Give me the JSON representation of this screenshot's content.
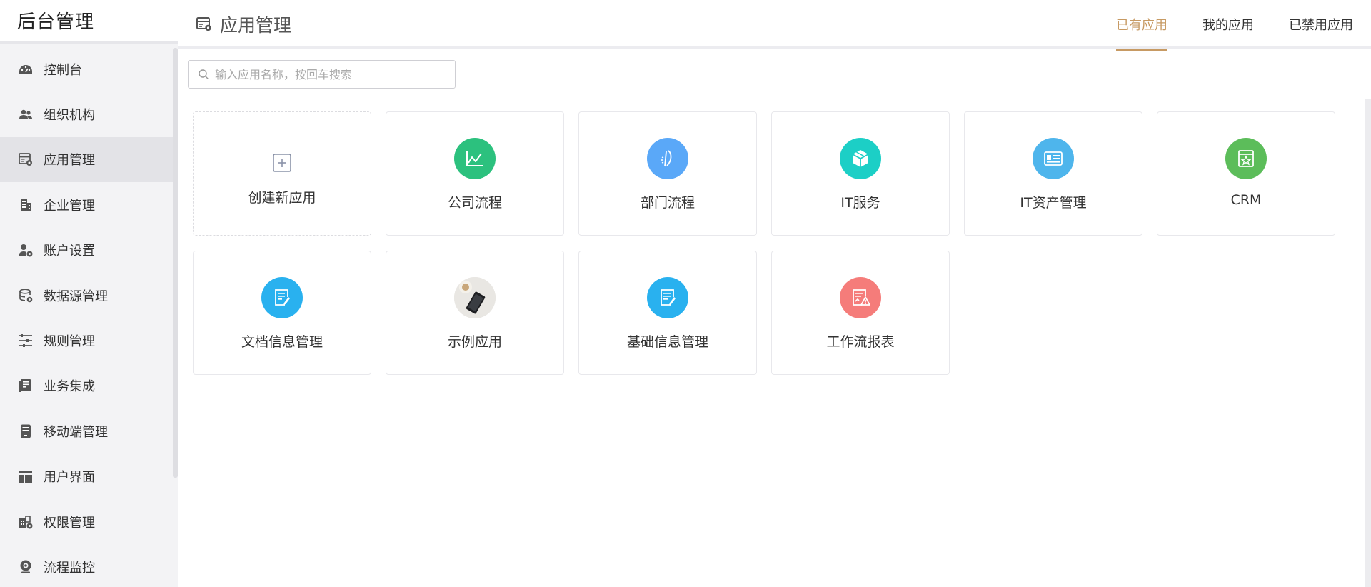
{
  "sidebar": {
    "title": "后台管理",
    "items": [
      {
        "label": "控制台",
        "icon": "dashboard-icon"
      },
      {
        "label": "组织机构",
        "icon": "users-icon"
      },
      {
        "label": "应用管理",
        "icon": "app-manage-icon",
        "active": true
      },
      {
        "label": "企业管理",
        "icon": "building-icon"
      },
      {
        "label": "账户设置",
        "icon": "user-gear-icon"
      },
      {
        "label": "数据源管理",
        "icon": "database-icon"
      },
      {
        "label": "规则管理",
        "icon": "sliders-icon"
      },
      {
        "label": "业务集成",
        "icon": "book-icon"
      },
      {
        "label": "移动端管理",
        "icon": "mobile-icon"
      },
      {
        "label": "用户界面",
        "icon": "layout-icon"
      },
      {
        "label": "权限管理",
        "icon": "permission-icon"
      },
      {
        "label": "流程监控",
        "icon": "monitor-icon"
      }
    ]
  },
  "header": {
    "title": "应用管理",
    "title_icon": "app-manage-icon",
    "tabs": [
      {
        "label": "已有应用",
        "active": true
      },
      {
        "label": "我的应用"
      },
      {
        "label": "已禁用应用"
      }
    ]
  },
  "search": {
    "placeholder": "输入应用名称，按回车搜索",
    "value": ""
  },
  "cards": [
    {
      "label": "创建新应用",
      "icon": "plus-square-icon",
      "create": true
    },
    {
      "label": "公司流程",
      "icon": "chart-line-icon",
      "color": "#2cc17e"
    },
    {
      "label": "部门流程",
      "icon": "signature-icon",
      "color": "#5aa8f8"
    },
    {
      "label": "IT服务",
      "icon": "cube-icon",
      "color": "#1ccfc6"
    },
    {
      "label": "IT资产管理",
      "icon": "id-card-icon",
      "color": "#4eb5ec"
    },
    {
      "label": "CRM",
      "icon": "star-box-icon",
      "color": "#5cbd5a"
    },
    {
      "label": "文档信息管理",
      "icon": "edit-document-icon",
      "color": "#29b1ef"
    },
    {
      "label": "示例应用",
      "icon": "photo-phone-coffee-icon",
      "color": "#e8e6e2"
    },
    {
      "label": "基础信息管理",
      "icon": "edit-document-icon",
      "color": "#29b1ef"
    },
    {
      "label": "工作流报表",
      "icon": "report-warning-icon",
      "color": "#f57c7a"
    }
  ],
  "colors": {
    "accent": "#c79a63",
    "sidebar_bg": "#f3f3f5",
    "sidebar_active": "#e3e3e7"
  }
}
